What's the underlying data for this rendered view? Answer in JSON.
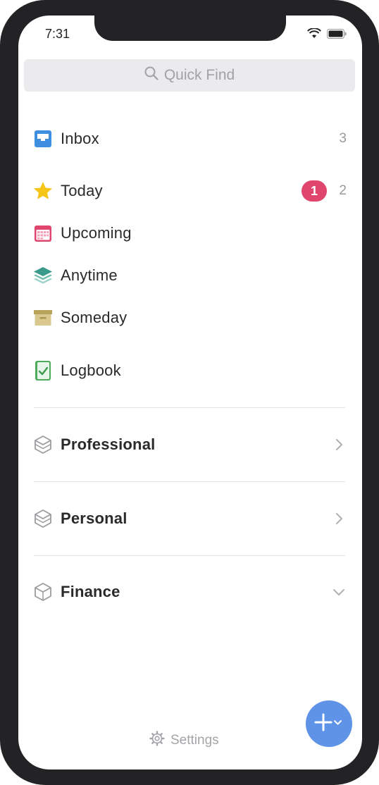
{
  "status_bar": {
    "time": "7:31"
  },
  "search": {
    "placeholder": "Quick Find"
  },
  "lists": [
    {
      "label": "Inbox",
      "count": "3",
      "icon": "inbox-icon"
    },
    {
      "label": "Today",
      "badge": "1",
      "count": "2",
      "icon": "star-icon"
    },
    {
      "label": "Upcoming",
      "icon": "calendar-icon"
    },
    {
      "label": "Anytime",
      "icon": "layers-icon"
    },
    {
      "label": "Someday",
      "icon": "archive-box-icon"
    },
    {
      "label": "Logbook",
      "icon": "logbook-icon"
    }
  ],
  "areas": [
    {
      "label": "Professional",
      "icon": "area-box-icon",
      "state": "collapsed"
    },
    {
      "label": "Personal",
      "icon": "area-box-icon",
      "state": "collapsed"
    },
    {
      "label": "Finance",
      "icon": "area-box-icon",
      "state": "expanded"
    }
  ],
  "footer": {
    "settings_label": "Settings"
  },
  "colors": {
    "accent": "#5f93e8",
    "badge": "#e0456d",
    "inbox": "#3f8fe0",
    "today": "#f5c518",
    "upcoming": "#e0456d",
    "anytime": "#3a9a8c",
    "someday": "#c7b36d",
    "logbook": "#4dab5b"
  }
}
